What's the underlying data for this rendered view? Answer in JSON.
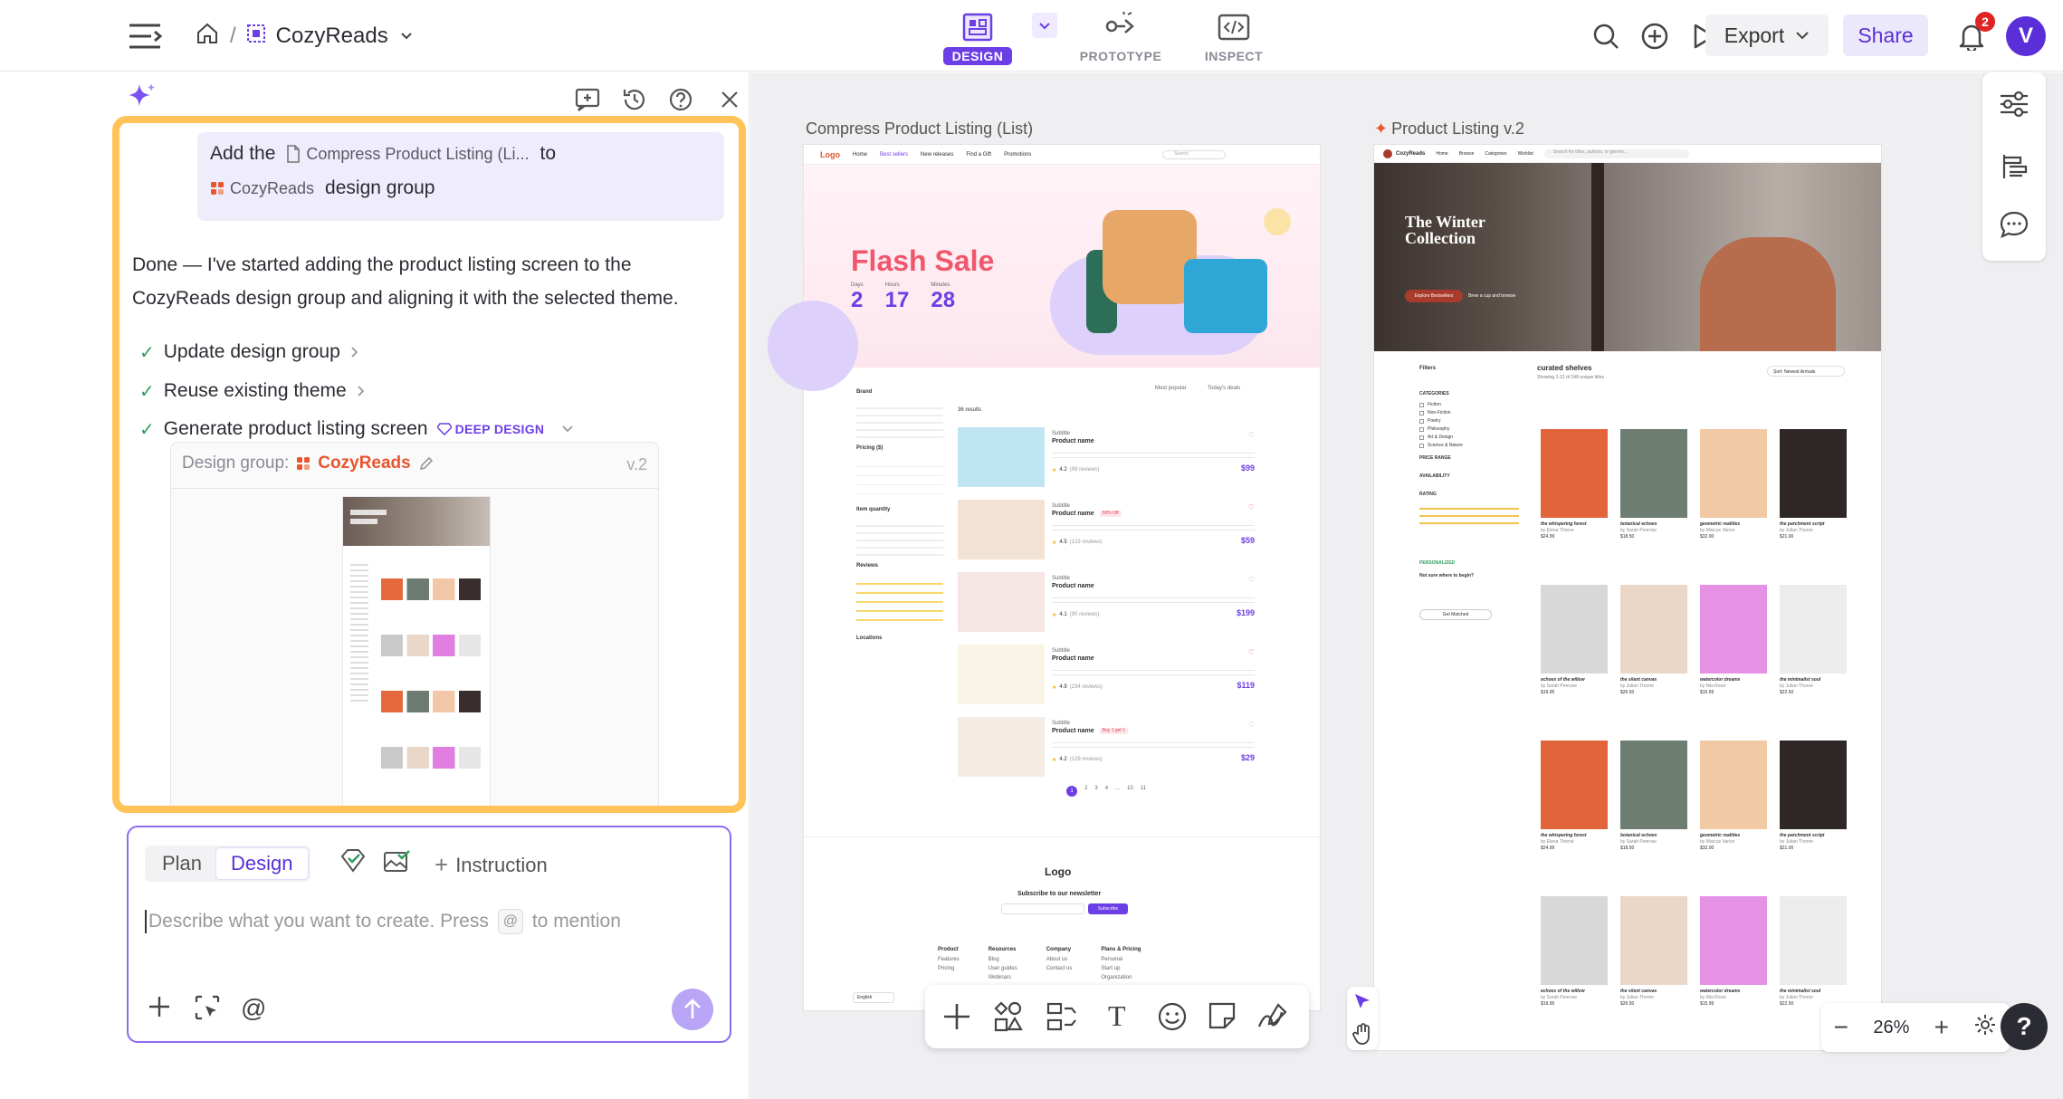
{
  "topbar": {
    "project_name": "CozyReads",
    "breadcrumb_sep": "/",
    "modes": [
      {
        "label": "DESIGN",
        "active": true
      },
      {
        "label": "PROTOTYPE",
        "active": false
      },
      {
        "label": "INSPECT",
        "active": false
      }
    ],
    "export_label": "Export",
    "share_label": "Share",
    "notification_count": "2",
    "avatar_initial": "V"
  },
  "chat": {
    "user_message": {
      "prefix": "Add the",
      "file_chip": "Compress Product Listing (Li...",
      "middle": "to",
      "group_chip": "CozyReads",
      "suffix": "design group"
    },
    "reply": "Done — I've started adding the product listing screen to the CozyReads design group and aligning it with the selected theme.",
    "steps": [
      {
        "label": "Update design group"
      },
      {
        "label": "Reuse existing theme"
      },
      {
        "label": "Generate product listing screen",
        "tag": "DEEP DESIGN"
      }
    ],
    "design_group": {
      "label": "Design group:",
      "name": "CozyReads",
      "version": "v.2"
    }
  },
  "composer": {
    "tabs": [
      {
        "label": "Plan",
        "active": false
      },
      {
        "label": "Design",
        "active": true
      }
    ],
    "instruction_label": "Instruction",
    "placeholder_before": "Describe what you want to create. Press",
    "mention_key": "@",
    "placeholder_after": "to mention"
  },
  "canvas": {
    "frame1": {
      "label": "Compress Product Listing (List)",
      "nav_logo": "Logo",
      "nav_links": [
        "Home",
        "Best sellers",
        "New releases",
        "Find a Gift",
        "Promotions"
      ],
      "search": "Search",
      "hero_title": "Flash Sale",
      "countdown": [
        {
          "label": "Days",
          "value": "2"
        },
        {
          "label": "Hours",
          "value": "17"
        },
        {
          "label": "Minutes",
          "value": "28"
        }
      ],
      "filters": [
        "Brand",
        "Pricing ($)",
        "Item quantity",
        "Reviews",
        "Locations"
      ],
      "results_text": "36 results",
      "sort_options": [
        "Most popular",
        "Today's deals"
      ],
      "products": [
        {
          "subtitle": "Subtitle",
          "name": "Product name",
          "rating": "4.2",
          "reviews": "(99 reviews)",
          "price": "$99",
          "tag": ""
        },
        {
          "subtitle": "Subtitle",
          "name": "Product name",
          "rating": "4.5",
          "reviews": "(123 reviews)",
          "price": "$59",
          "tag": "50% Off"
        },
        {
          "subtitle": "Subtitle",
          "name": "Product name",
          "rating": "4.1",
          "reviews": "(90 reviews)",
          "price": "$199",
          "tag": ""
        },
        {
          "subtitle": "Subtitle",
          "name": "Product name",
          "rating": "4.9",
          "reviews": "(234 reviews)",
          "price": "$119",
          "tag": ""
        },
        {
          "subtitle": "Subtitle",
          "name": "Product name",
          "rating": "4.2",
          "reviews": "(129 reviews)",
          "price": "$29",
          "tag": "Buy 1 get 1"
        }
      ],
      "pagination": [
        "1",
        "2",
        "3",
        "4",
        "...",
        "10",
        "11"
      ],
      "footer_logo": "Logo",
      "newsletter_title": "Subscribe to our newsletter",
      "subscribe_btn": "Subscribe",
      "footer_cols": [
        {
          "title": "Product",
          "items": [
            "Features",
            "Pricing"
          ]
        },
        {
          "title": "Resources",
          "items": [
            "Blog",
            "User guides",
            "Webinars"
          ]
        },
        {
          "title": "Company",
          "items": [
            "About us",
            "Contact us"
          ]
        },
        {
          "title": "Plans & Pricing",
          "items": [
            "Personal",
            "Start up",
            "Organization"
          ]
        }
      ],
      "language": "English"
    },
    "frame2": {
      "label": "Product Listing v.2",
      "brand": "CozyReads",
      "nav_links": [
        "Home",
        "Browse",
        "Categories",
        "Wishlist"
      ],
      "search": "Search for titles, authors, or genres...",
      "hero_title": "The Winter Collection",
      "hero_cta": "Explore Bestsellers",
      "hero_link": "Brew a cup and browse",
      "section_title": "curated shelves",
      "showing": "Showing 1-12 of 248 unique titles",
      "sort": "Sort: Newest Arrivals",
      "filters_title": "Filters",
      "filter_groups": [
        "CATEGORIES",
        "PRICE RANGE",
        "AVAILABILITY",
        "RATING"
      ],
      "categories": [
        "Fiction",
        "Non-Fiction",
        "Poetry",
        "Philosophy",
        "Art & Design",
        "Science & Nature"
      ],
      "personalized": "PERSONALIZED",
      "not_sure": "Not sure where to begin?",
      "get_matched": "Get Matched",
      "books": [
        {
          "title": "the whispering forest",
          "author": "by Elena Thorne",
          "price": "$24.99"
        },
        {
          "title": "botanical echoes",
          "author": "by Sarah Penrose",
          "price": "$18.50"
        },
        {
          "title": "geometric realities",
          "author": "by Marcus Vance",
          "price": "$32.00"
        },
        {
          "title": "the parchment script",
          "author": "by Julian Thorne",
          "price": "$21.00"
        },
        {
          "title": "echoes of the willow",
          "author": "by Sarah Penrose",
          "price": "$19.95"
        },
        {
          "title": "the silent canvas",
          "author": "by Julian Thorne",
          "price": "$26.50"
        },
        {
          "title": "watercolor dreams",
          "author": "by Mia Rossi",
          "price": "$15.99"
        },
        {
          "title": "the minimalist soul",
          "author": "by Julian Thorne",
          "price": "$22.50"
        }
      ]
    },
    "zoom": "26%"
  }
}
